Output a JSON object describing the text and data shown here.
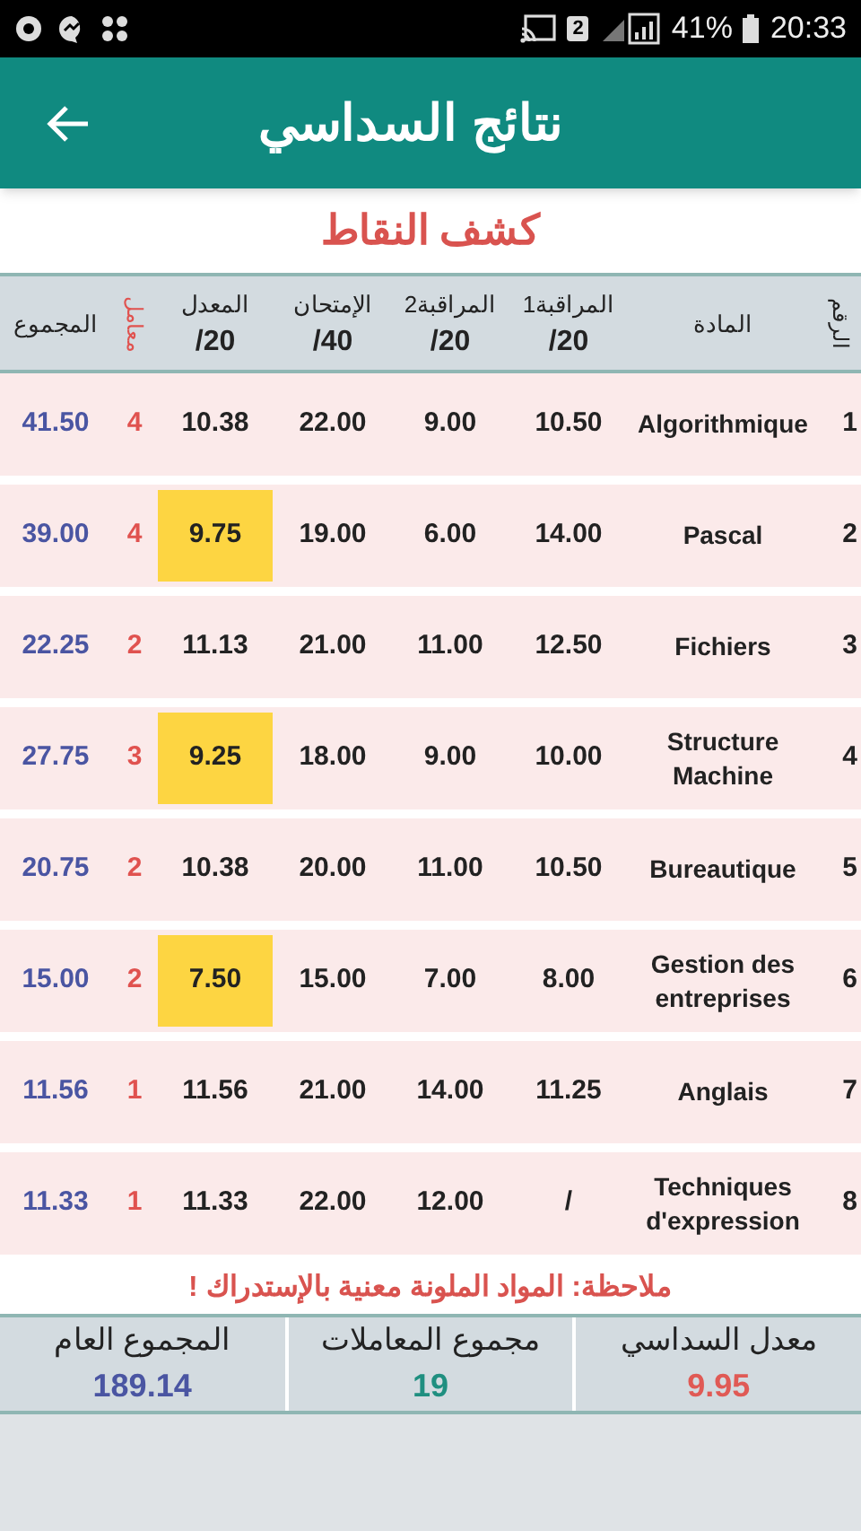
{
  "status_bar": {
    "sim": "2",
    "battery_text": "41%",
    "time": "20:33"
  },
  "app_bar": {
    "title": "نتائج السداسي"
  },
  "section_title": "كشف النقاط",
  "columns": {
    "number": {
      "label": "الرقم",
      "kind": "vertical"
    },
    "subject": {
      "label": "المادة",
      "kind": "normal"
    },
    "cc1": {
      "label": "المراقبة1",
      "sub": "/20",
      "kind": "normal"
    },
    "cc2": {
      "label": "المراقبة2",
      "sub": "/20",
      "kind": "normal"
    },
    "exam": {
      "label": "الإمتحان",
      "sub": "/40",
      "kind": "normal"
    },
    "average": {
      "label": "المعدل",
      "sub": "/20",
      "kind": "normal"
    },
    "coefficient": {
      "label": "معامل",
      "kind": "vertical"
    },
    "total": {
      "label": "المجموع",
      "kind": "normal"
    }
  },
  "rows": [
    {
      "number": "1",
      "subject": "Algorithmique",
      "cc1": "10.50",
      "cc2": "9.00",
      "exam": "22.00",
      "average": "10.38",
      "needs_retake": false,
      "coefficient": "4",
      "total": "41.50"
    },
    {
      "number": "2",
      "subject": "Pascal",
      "cc1": "14.00",
      "cc2": "6.00",
      "exam": "19.00",
      "average": "9.75",
      "needs_retake": true,
      "coefficient": "4",
      "total": "39.00"
    },
    {
      "number": "3",
      "subject": "Fichiers",
      "cc1": "12.50",
      "cc2": "11.00",
      "exam": "21.00",
      "average": "11.13",
      "needs_retake": false,
      "coefficient": "2",
      "total": "22.25"
    },
    {
      "number": "4",
      "subject": "Structure Machine",
      "cc1": "10.00",
      "cc2": "9.00",
      "exam": "18.00",
      "average": "9.25",
      "needs_retake": true,
      "coefficient": "3",
      "total": "27.75"
    },
    {
      "number": "5",
      "subject": "Bureautique",
      "cc1": "10.50",
      "cc2": "11.00",
      "exam": "20.00",
      "average": "10.38",
      "needs_retake": false,
      "coefficient": "2",
      "total": "20.75"
    },
    {
      "number": "6",
      "subject": "Gestion des entreprises",
      "cc1": "8.00",
      "cc2": "7.00",
      "exam": "15.00",
      "average": "7.50",
      "needs_retake": true,
      "coefficient": "2",
      "total": "15.00"
    },
    {
      "number": "7",
      "subject": "Anglais",
      "cc1": "11.25",
      "cc2": "14.00",
      "exam": "21.00",
      "average": "11.56",
      "needs_retake": false,
      "coefficient": "1",
      "total": "11.56"
    },
    {
      "number": "8",
      "subject": "Techniques d'expression",
      "cc1": "/",
      "cc2": "12.00",
      "exam": "22.00",
      "average": "11.33",
      "needs_retake": false,
      "coefficient": "1",
      "total": "11.33"
    }
  ],
  "note": "ملاحظة: المواد الملونة معنية بالإستدراك !",
  "summary": {
    "semester_average": {
      "label": "معدل السداسي",
      "value": "9.95",
      "color": "#e05a55"
    },
    "coefficient_sum": {
      "label": "مجموع المعاملات",
      "value": "19",
      "color": "#1f8f80"
    },
    "grand_total": {
      "label": "المجموع العام",
      "value": "189.14",
      "color": "#4a55a2"
    }
  }
}
